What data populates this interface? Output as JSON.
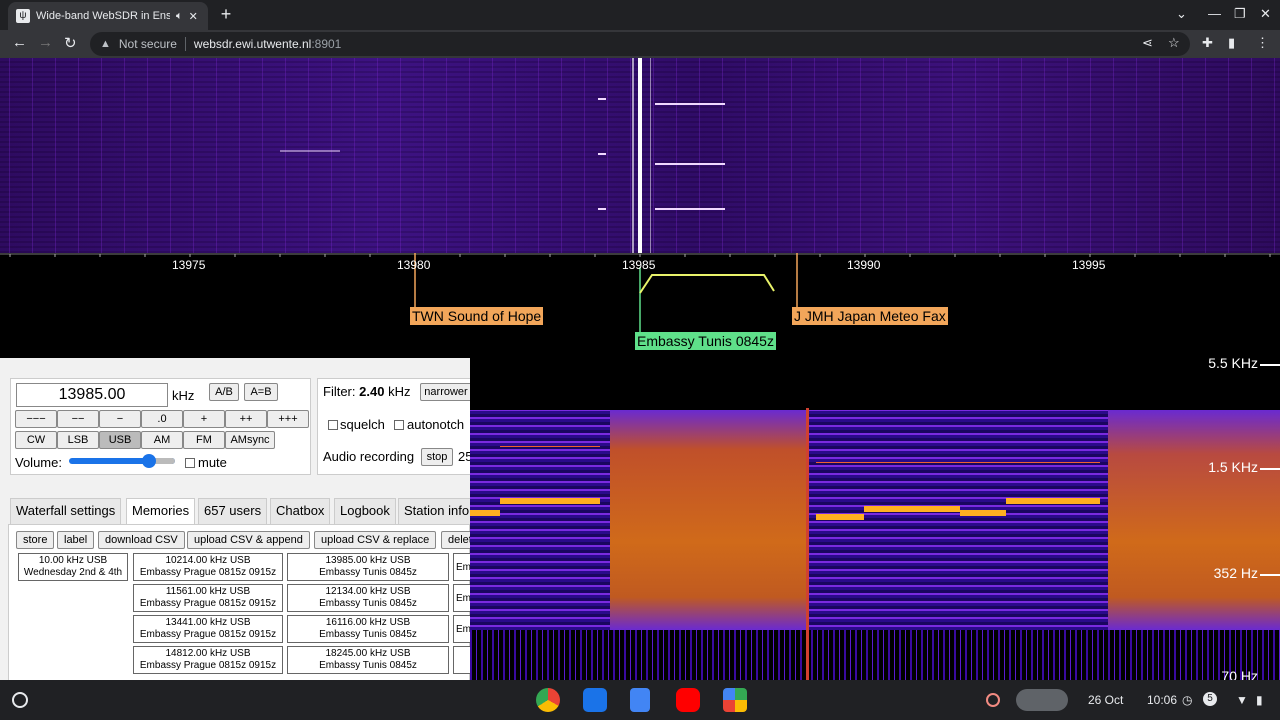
{
  "browser": {
    "tab_title": "Wide-band WebSDR in Enschede",
    "new_tab_icon": "+",
    "not_secure": "Not secure",
    "host": "websdr.ewi.utwente.nl",
    "port": ":8901"
  },
  "scale": {
    "ticks": [
      "13975",
      "13980",
      "13985",
      "13990",
      "13995"
    ]
  },
  "labels": {
    "twn": "TWN Sound of Hope",
    "jmh": "J JMH Japan Meteo Fax",
    "tunis": "Embassy Tunis 0845z"
  },
  "controls": {
    "frequency": "13985.00",
    "khz": "kHz",
    "ab": "A/B",
    "aeqb": "A=B",
    "steps": [
      "−−−",
      "−−",
      "−",
      ".0",
      "+",
      "++",
      "+++"
    ],
    "modes": [
      "CW",
      "LSB",
      "USB",
      "AM",
      "FM",
      "AMsync"
    ],
    "selected_mode": "USB",
    "volume_label": "Volume:",
    "volume_level": 0.78,
    "mute": "mute",
    "filter_label": "Filter:",
    "filter_value": "2.40",
    "filter_unit": "kHz",
    "narrower": "narrower",
    "squelch": "squelch",
    "autonotch": "autonotch",
    "audio_recording": "Audio recording",
    "stop": "stop",
    "rec_count": "25"
  },
  "tabs": [
    "Waterfall settings",
    "Memories",
    "657 users",
    "Chatbox",
    "Logbook",
    "Station info"
  ],
  "active_tab": "Memories",
  "memories": {
    "buttons": [
      "store",
      "label",
      "download CSV",
      "upload CSV & append",
      "upload CSV & replace",
      "delete"
    ],
    "entries": [
      {
        "freq": "10.00 kHz USB",
        "name": "Wednesday 2nd & 4th"
      },
      {
        "freq": "10214.00 kHz USB",
        "name": "Embassy Prague 0815z 0915z"
      },
      {
        "freq": "13985.00 kHz USB",
        "name": "Embassy Tunis 0845z"
      },
      {
        "freq": "11561.00 kHz USB",
        "name": "Embassy Prague 0815z 0915z"
      },
      {
        "freq": "12134.00 kHz USB",
        "name": "Embassy Tunis 0845z"
      },
      {
        "freq": "13441.00 kHz USB",
        "name": "Embassy Prague 0815z 0915z"
      },
      {
        "freq": "16116.00 kHz USB",
        "name": "Embassy Tunis 0845z"
      },
      {
        "freq": "14812.00 kHz USB",
        "name": "Embassy Prague 0815z 0915z"
      },
      {
        "freq": "18245.00 kHz USB",
        "name": "Embassy Tunis 0845z"
      }
    ],
    "partial": "Em"
  },
  "spectrogram": {
    "labels": [
      "5.5 KHz",
      "1.5 KHz",
      "352 Hz",
      "70 Hz"
    ]
  },
  "shelf": {
    "date": "26 Oct",
    "time": "10:06",
    "badge": "5"
  },
  "colors": {
    "accent": "#1a73e8",
    "orange_label": "#f2a65a",
    "green_label": "#5fe08a",
    "passband": "#e8f26a"
  }
}
